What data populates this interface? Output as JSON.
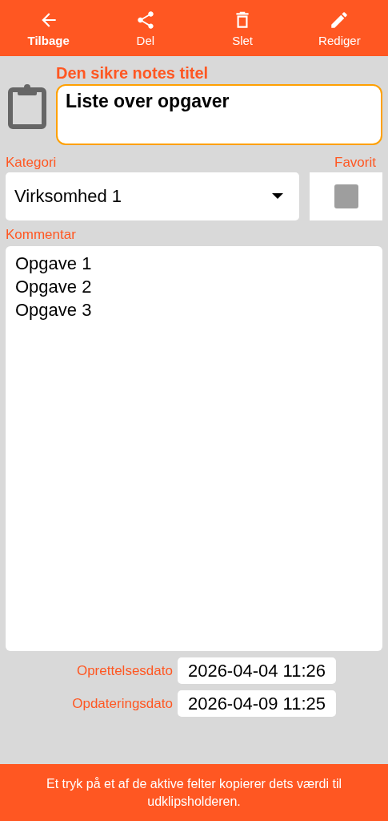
{
  "toolbar": [
    {
      "kind": "back",
      "label": "Tilbage",
      "emphasized": true
    },
    {
      "kind": "share",
      "label": "Del",
      "emphasized": false
    },
    {
      "kind": "delete",
      "label": "Slet",
      "emphasized": false
    },
    {
      "kind": "edit",
      "label": "Rediger",
      "emphasized": false
    }
  ],
  "title": {
    "label": "Den sikre notes titel",
    "value": "Liste over opgaver"
  },
  "category": {
    "label": "Kategori",
    "value": "Virksomhed 1"
  },
  "favorite": {
    "label": "Favorit",
    "checked": false
  },
  "comment": {
    "label": "Kommentar",
    "value": "Opgave 1\nOpgave 2\nOpgave 3"
  },
  "dates": [
    {
      "label": "Oprettelsesdato",
      "value": "2026-04-04 11:26"
    },
    {
      "label": "Opdateringsdato",
      "value": "2026-04-09 11:25"
    }
  ],
  "footer": "Et tryk på et af de aktive felter kopierer dets værdi til udklipsholderen."
}
